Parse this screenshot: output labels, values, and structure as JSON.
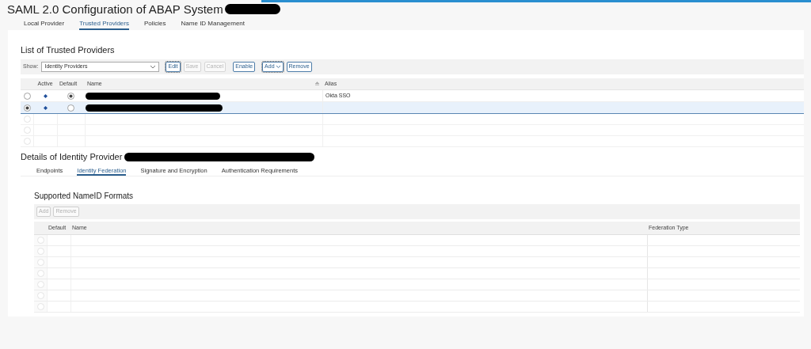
{
  "title": "SAML 2.0 Configuration of ABAP System",
  "title_redacted": true,
  "tabs": [
    {
      "label": "Local Provider",
      "selected": false
    },
    {
      "label": "Trusted Providers",
      "selected": true
    },
    {
      "label": "Policies",
      "selected": false
    },
    {
      "label": "Name ID Management",
      "selected": false
    }
  ],
  "providers": {
    "heading": "List of Trusted Providers",
    "show_label": "Show:",
    "show_value": "Identity Providers",
    "buttons": [
      {
        "label": "Edit",
        "kind": "plain",
        "disabled": false,
        "focused": true
      },
      {
        "label": "Save",
        "kind": "plain",
        "disabled": true,
        "focused": false
      },
      {
        "label": "Cancel",
        "kind": "plain",
        "disabled": true,
        "focused": false
      },
      {
        "label": "Enable",
        "kind": "plain",
        "disabled": false,
        "focused": false
      },
      {
        "label": "Add",
        "kind": "menu",
        "disabled": false,
        "focused": true
      },
      {
        "label": "Remove",
        "kind": "plain",
        "disabled": false,
        "focused": false
      }
    ],
    "columns": [
      "Active",
      "Default",
      "Name",
      "Alias"
    ],
    "rows": [
      {
        "selected": false,
        "active": true,
        "default": true,
        "name_redacted": true,
        "alias": "Okta SSO"
      },
      {
        "selected": true,
        "active": true,
        "default": false,
        "name_redacted": true
      },
      {
        "selected": false,
        "disabled": true
      },
      {
        "selected": false,
        "disabled": true
      },
      {
        "selected": false,
        "disabled": true
      }
    ]
  },
  "details": {
    "heading": "Details of Identity Provider",
    "name_redacted": true,
    "tabs": [
      {
        "label": "Endpoints",
        "selected": false
      },
      {
        "label": "Identity Federation",
        "selected": true
      },
      {
        "label": "Signature and Encryption",
        "selected": false
      },
      {
        "label": "Authentication Requirements",
        "selected": false
      }
    ],
    "section_title": "Supported NameID Formats",
    "buttons": [
      {
        "label": "Add",
        "disabled": true
      },
      {
        "label": "Remove",
        "disabled": true
      }
    ],
    "columns": [
      "Default",
      "Name",
      "Federation Type"
    ],
    "rows": [
      {
        "selected": false,
        "disabled": true
      },
      {
        "selected": false,
        "disabled": true
      },
      {
        "selected": false,
        "disabled": true
      },
      {
        "selected": false,
        "disabled": true
      },
      {
        "selected": false,
        "disabled": true
      },
      {
        "selected": false,
        "disabled": true
      },
      {
        "selected": false,
        "disabled": true
      }
    ]
  }
}
